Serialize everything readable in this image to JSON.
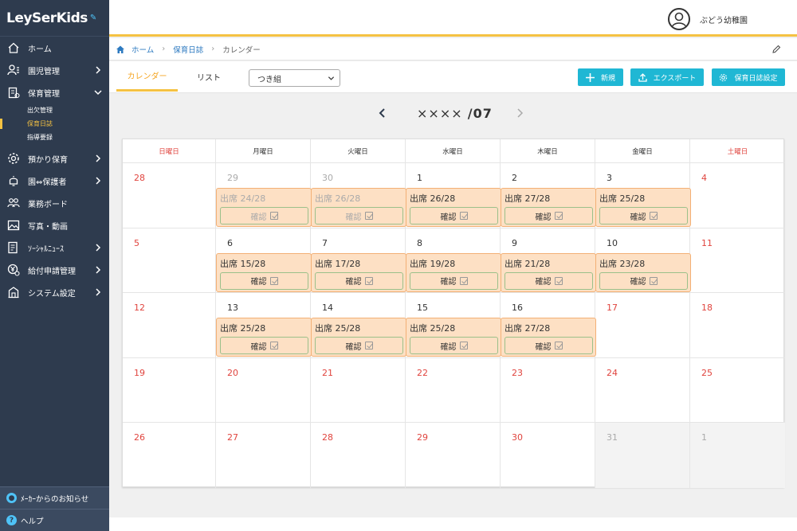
{
  "app": {
    "logo": "LeySerKids"
  },
  "header": {
    "user_name": "ぶどう幼稚園"
  },
  "sidebar": {
    "items": [
      {
        "label": "ホーム",
        "icon": "home-icon",
        "chevron": ""
      },
      {
        "label": "園児管理",
        "icon": "child-icon",
        "chevron": "right"
      },
      {
        "label": "保育管理",
        "icon": "clipboard-icon",
        "chevron": "down"
      },
      {
        "label": "預かり保育",
        "icon": "gear-icon",
        "chevron": "right"
      },
      {
        "label": "園⇔保護者",
        "icon": "bell-icon",
        "chevron": "right"
      },
      {
        "label": "業務ボード",
        "icon": "people-icon",
        "chevron": ""
      },
      {
        "label": "写真・動画",
        "icon": "image-icon",
        "chevron": ""
      },
      {
        "label": "ｿｰｼｬﾙﾆｭｰｽ",
        "icon": "news-icon",
        "chevron": "right"
      },
      {
        "label": "給付申請管理",
        "icon": "yen-icon",
        "chevron": "right"
      },
      {
        "label": "システム設定",
        "icon": "building-icon",
        "chevron": "right"
      }
    ],
    "sub_items": [
      "出欠管理",
      "保育日誌",
      "指導要録"
    ],
    "bottom": {
      "notice": "ﾒｰｶｰからのお知らせ",
      "help": "ヘルプ"
    }
  },
  "breadcrumb": {
    "home": "ホーム",
    "journal": "保育日誌",
    "current": "カレンダー"
  },
  "toolbar": {
    "tab_calendar": "カレンダー",
    "tab_list": "リスト",
    "class_select": "つき組",
    "btn_new": "新規",
    "btn_export": "エクスポート",
    "btn_settings": "保育日誌設定"
  },
  "month": {
    "year": "××××",
    "month": "/07"
  },
  "calendar": {
    "weekdays": [
      "日曜日",
      "月曜日",
      "火曜日",
      "水曜日",
      "木曜日",
      "金曜日",
      "土曜日"
    ],
    "confirm_label": "確認",
    "weeks": [
      [
        {
          "day": "28",
          "tone": "red"
        },
        {
          "day": "29",
          "tone": "grey",
          "attendance": "出席 24/28",
          "faded": true
        },
        {
          "day": "30",
          "tone": "grey",
          "attendance": "出席 26/28",
          "faded": true
        },
        {
          "day": "1",
          "tone": "normal",
          "attendance": "出席 26/28"
        },
        {
          "day": "2",
          "tone": "normal",
          "attendance": "出席 27/28"
        },
        {
          "day": "3",
          "tone": "normal",
          "attendance": "出席 25/28"
        },
        {
          "day": "4",
          "tone": "red"
        }
      ],
      [
        {
          "day": "5",
          "tone": "red"
        },
        {
          "day": "6",
          "tone": "normal",
          "attendance": "出席 15/28"
        },
        {
          "day": "7",
          "tone": "normal",
          "attendance": "出席 17/28"
        },
        {
          "day": "8",
          "tone": "normal",
          "attendance": "出席 19/28"
        },
        {
          "day": "9",
          "tone": "normal",
          "attendance": "出席 21/28"
        },
        {
          "day": "10",
          "tone": "normal",
          "attendance": "出席 23/28"
        },
        {
          "day": "11",
          "tone": "red"
        }
      ],
      [
        {
          "day": "12",
          "tone": "red"
        },
        {
          "day": "13",
          "tone": "normal",
          "attendance": "出席 25/28"
        },
        {
          "day": "14",
          "tone": "normal",
          "attendance": "出席 25/28"
        },
        {
          "day": "15",
          "tone": "normal",
          "attendance": "出席 25/28"
        },
        {
          "day": "16",
          "tone": "normal",
          "attendance": "出席 27/28"
        },
        {
          "day": "17",
          "tone": "red"
        },
        {
          "day": "18",
          "tone": "red"
        }
      ],
      [
        {
          "day": "19",
          "tone": "red"
        },
        {
          "day": "20",
          "tone": "red"
        },
        {
          "day": "21",
          "tone": "red"
        },
        {
          "day": "22",
          "tone": "red"
        },
        {
          "day": "23",
          "tone": "red"
        },
        {
          "day": "24",
          "tone": "red"
        },
        {
          "day": "25",
          "tone": "red"
        }
      ],
      [
        {
          "day": "26",
          "tone": "red"
        },
        {
          "day": "27",
          "tone": "red"
        },
        {
          "day": "28",
          "tone": "red"
        },
        {
          "day": "29",
          "tone": "red"
        },
        {
          "day": "30",
          "tone": "red"
        },
        {
          "day": "31",
          "tone": "grey",
          "muted": true
        },
        {
          "day": "1",
          "tone": "grey",
          "muted": true
        }
      ]
    ]
  },
  "colors": {
    "accent": "#f5c242",
    "button": "#1fb7d4",
    "sidebar": "#2e3b4e",
    "holiday": "#e0443e",
    "attendance_bg": "#fde0c4"
  }
}
